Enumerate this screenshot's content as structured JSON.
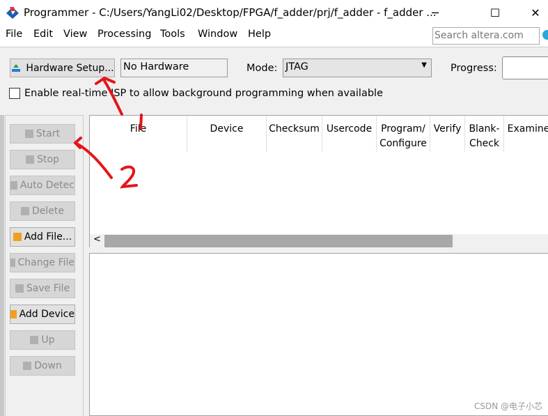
{
  "window": {
    "title": "Programmer - C:/Users/YangLi02/Desktop/FPGA/f_adder/prj/f_adder - f_adder ...",
    "minimize": "─",
    "maximize": "☐",
    "close": "✕"
  },
  "menu": [
    "File",
    "Edit",
    "View",
    "Processing",
    "Tools",
    "Window",
    "Help"
  ],
  "search": {
    "placeholder": "Search altera.com"
  },
  "toolbar": {
    "hardware_setup": "Hardware Setup...",
    "hardware_value": "No Hardware",
    "mode_label": "Mode:",
    "mode_value": "JTAG",
    "progress_label": "Progress:"
  },
  "realtime_isp": {
    "label": "Enable real-time ISP to allow background programming when available",
    "checked": false
  },
  "side_buttons": [
    {
      "label": "Start",
      "enabled": false,
      "icon": "start-icon"
    },
    {
      "label": "Stop",
      "enabled": false,
      "icon": "stop-icon"
    },
    {
      "label": "Auto Detec",
      "enabled": false,
      "icon": "auto-detect-icon"
    },
    {
      "label": "Delete",
      "enabled": false,
      "icon": "delete-icon"
    },
    {
      "label": "Add File...",
      "enabled": true,
      "icon": "add-file-icon"
    },
    {
      "label": "Change File",
      "enabled": false,
      "icon": "change-file-icon"
    },
    {
      "label": "Save File",
      "enabled": false,
      "icon": "save-file-icon"
    },
    {
      "label": "Add Device",
      "enabled": true,
      "icon": "add-device-icon"
    },
    {
      "label": "Up",
      "enabled": false,
      "icon": "up-icon"
    },
    {
      "label": "Down",
      "enabled": false,
      "icon": "down-icon"
    }
  ],
  "table": {
    "columns": [
      "File",
      "Device",
      "Checksum",
      "Usercode",
      "Program/\nConfigure",
      "Verify",
      "Blank-\nCheck",
      "Examine"
    ]
  },
  "annotations": [
    "1",
    "2"
  ],
  "watermark": "CSDN @电子小芯",
  "colors": {
    "annotation": "#e3161b"
  }
}
